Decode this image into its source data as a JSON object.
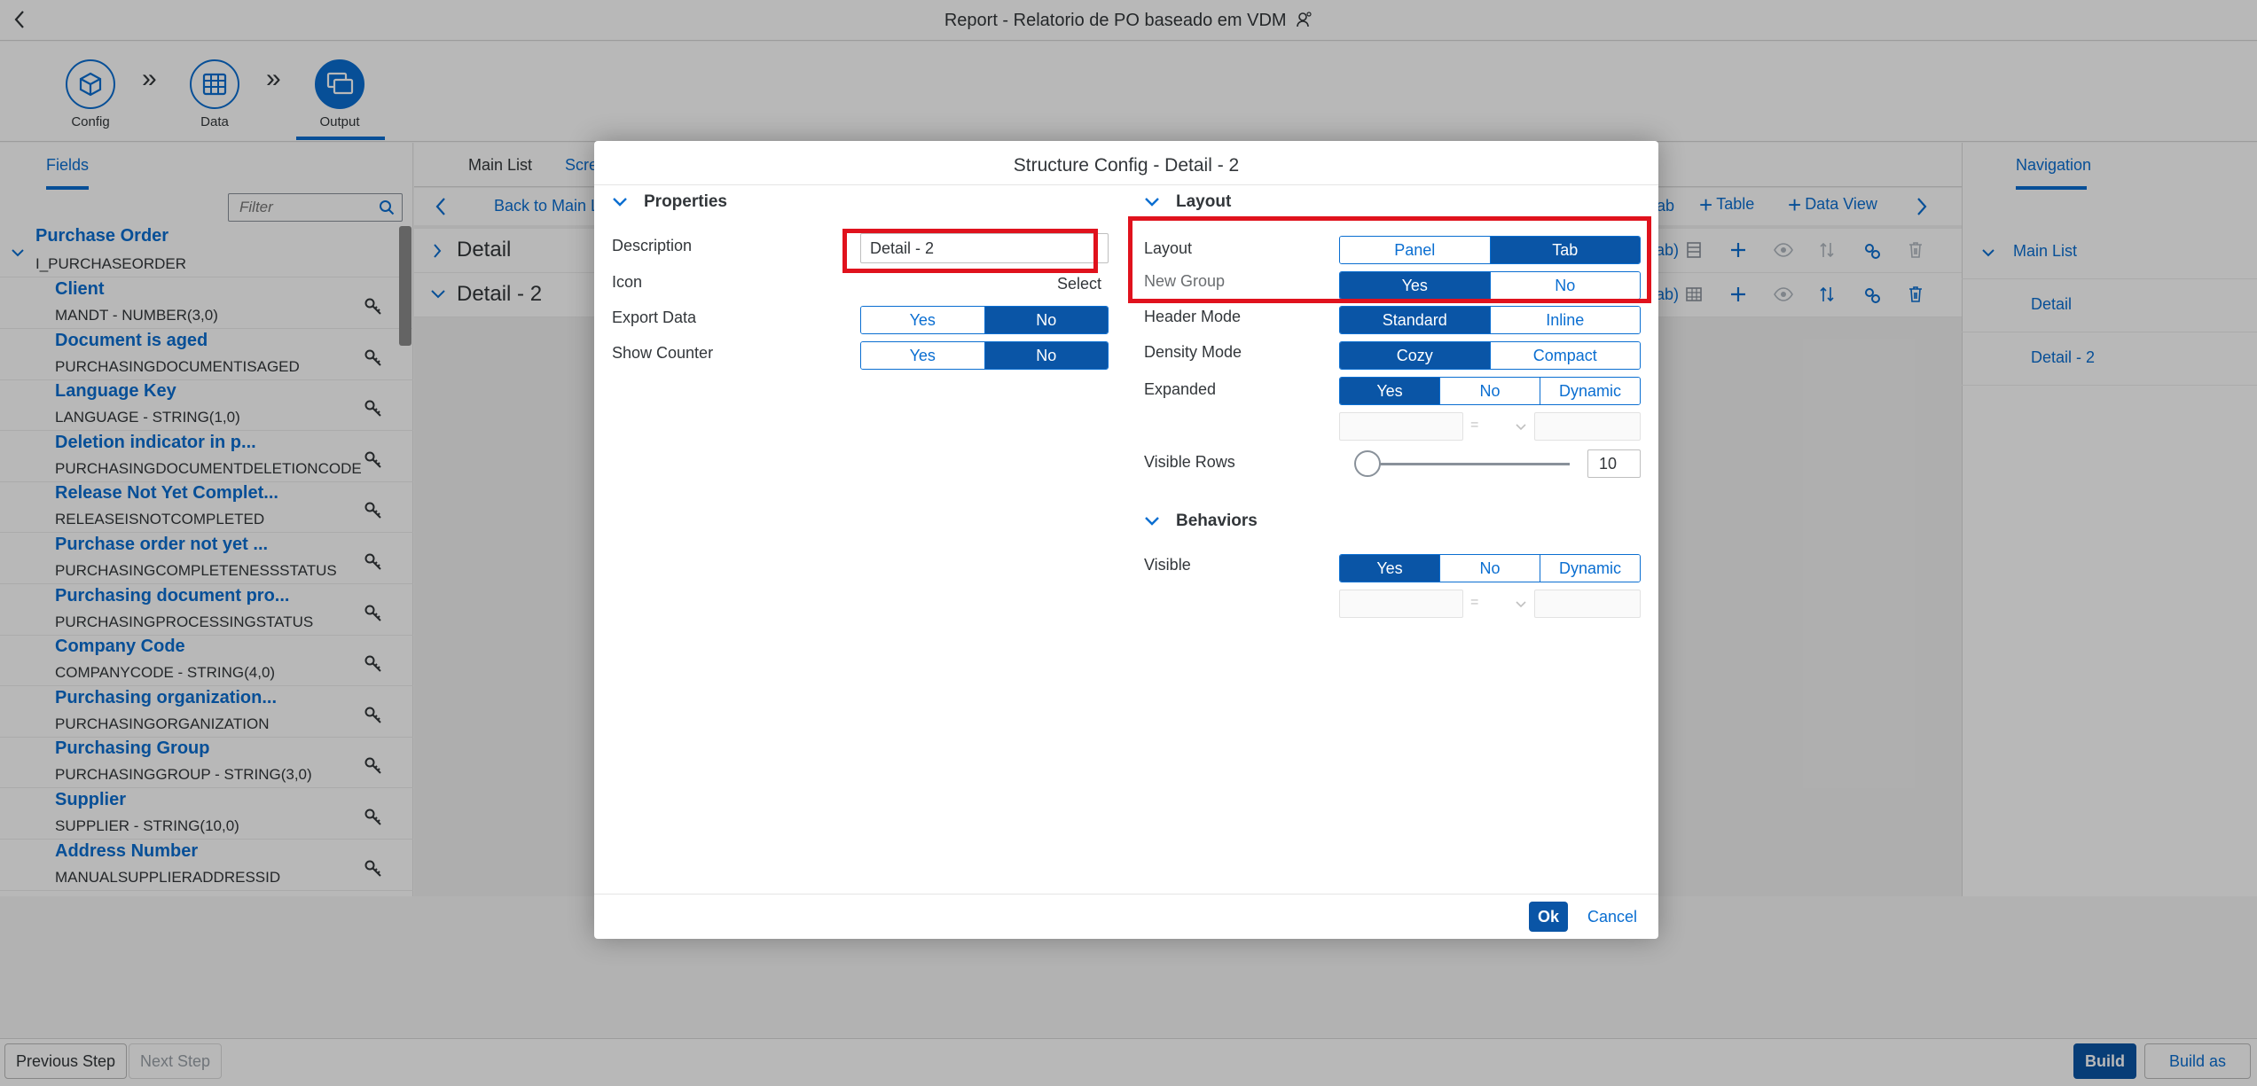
{
  "app": {
    "title": "Report - Relatorio de PO baseado em VDM"
  },
  "steps": [
    {
      "label": "Config",
      "icon": "package-icon"
    },
    {
      "label": "Data",
      "icon": "table-grid-icon"
    },
    {
      "label": "Output",
      "icon": "screens-icon"
    }
  ],
  "left": {
    "tab": "Fields",
    "filter_placeholder": "Filter",
    "root": {
      "name": "Purchase Order",
      "tech": "I_PURCHASEORDER"
    },
    "fields": [
      {
        "name": "Client",
        "tech": "MANDT - NUMBER(3,0)"
      },
      {
        "name": "Document is aged",
        "tech": "PURCHASINGDOCUMENTISAGED"
      },
      {
        "name": "Language Key",
        "tech": "LANGUAGE - STRING(1,0)"
      },
      {
        "name": "Deletion indicator in p...",
        "tech": "PURCHASINGDOCUMENTDELETIONCODE"
      },
      {
        "name": "Release Not Yet Complet...",
        "tech": "RELEASEISNOTCOMPLETED"
      },
      {
        "name": "Purchase order not yet ...",
        "tech": "PURCHASINGCOMPLETENESSSTATUS"
      },
      {
        "name": "Purchasing document pro...",
        "tech": "PURCHASINGPROCESSINGSTATUS"
      },
      {
        "name": "Company Code",
        "tech": "COMPANYCODE - STRING(4,0)"
      },
      {
        "name": "Purchasing organization...",
        "tech": "PURCHASINGORGANIZATION"
      },
      {
        "name": "Purchasing Group",
        "tech": "PURCHASINGGROUP - STRING(3,0)"
      },
      {
        "name": "Supplier",
        "tech": "SUPPLIER - STRING(10,0)"
      },
      {
        "name": "Address Number",
        "tech": "MANUALSUPPLIERADDRESSID"
      }
    ]
  },
  "center": {
    "tabs": [
      "Main List",
      "Scre"
    ],
    "toolbar": {
      "back": "Back to Main L",
      "tab_frag": "ab",
      "table": "Table",
      "data_view": "Data View"
    },
    "rows": [
      {
        "label": "Detail",
        "frag": "ab)"
      },
      {
        "label": "Detail - 2",
        "frag": "ab)"
      }
    ]
  },
  "right": {
    "tab": "Navigation",
    "items": [
      "Main List",
      "Detail",
      "Detail - 2"
    ]
  },
  "footer": {
    "previous": "Previous Step",
    "next": "Next Step",
    "build": "Build",
    "build_new": "Build as new"
  },
  "dialog": {
    "title": "Structure Config - Detail - 2",
    "properties": {
      "heading": "Properties",
      "description_label": "Description",
      "description_value": "Detail - 2",
      "icon_label": "Icon",
      "icon_link": "Select",
      "export_label": "Export Data",
      "counter_label": "Show Counter",
      "yes": "Yes",
      "no": "No"
    },
    "layout": {
      "heading": "Layout",
      "layout_label": "Layout",
      "panel": "Panel",
      "tab": "Tab",
      "newgroup_label": "New Group",
      "yes": "Yes",
      "no": "No",
      "header_label": "Header Mode",
      "standard": "Standard",
      "inline": "Inline",
      "density_label": "Density Mode",
      "cozy": "Cozy",
      "compact": "Compact",
      "expanded_label": "Expanded",
      "dynamic": "Dynamic",
      "eq": "=",
      "visible_rows_label": "Visible Rows",
      "visible_rows_value": "10",
      "slider_fraction": 0.05
    },
    "behaviors": {
      "heading": "Behaviors",
      "visible_label": "Visible",
      "yes": "Yes",
      "no": "No",
      "dynamic": "Dynamic",
      "eq": "="
    },
    "ok": "Ok",
    "cancel": "Cancel"
  },
  "colors": {
    "accent": "#0a6ed1",
    "selected": "#0a55a6",
    "highlight": "#e0121d"
  }
}
